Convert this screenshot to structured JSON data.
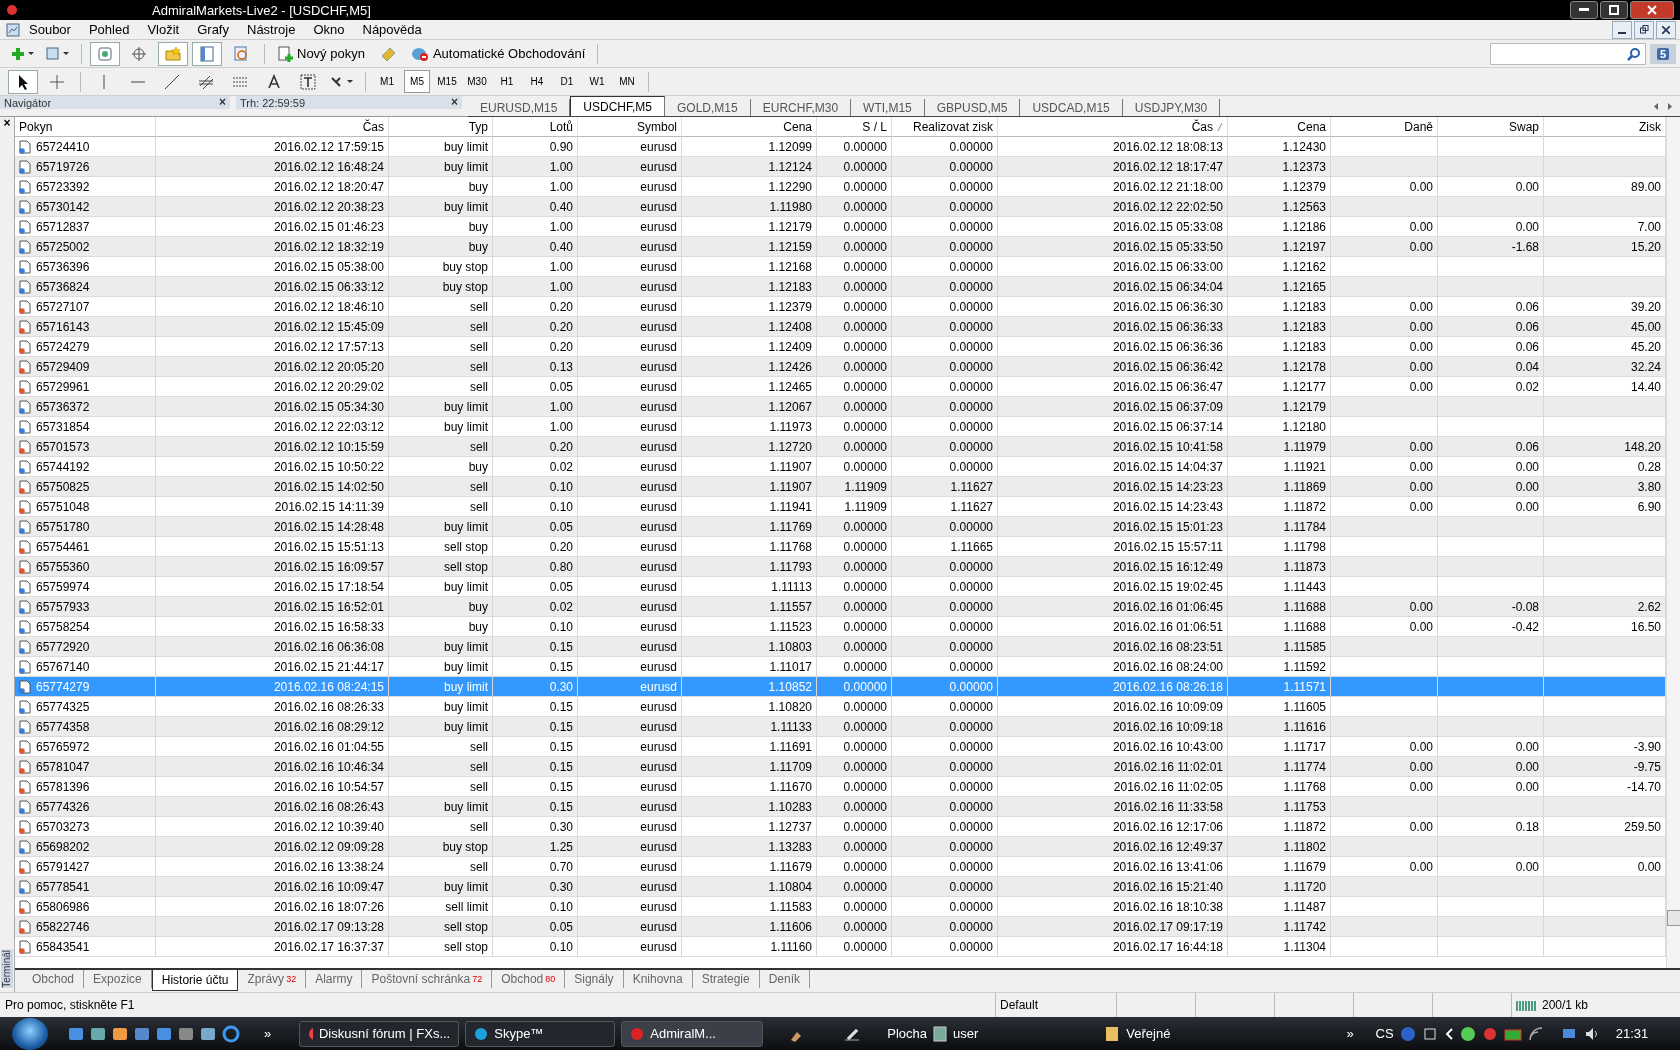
{
  "window": {
    "title": "AdmiralMarkets-Live2 - [USDCHF,M5]"
  },
  "menu": [
    "Soubor",
    "Pohled",
    "Vložit",
    "Grafy",
    "Nástroje",
    "Okno",
    "Nápověda"
  ],
  "toolbar": {
    "new_order": "Nový pokyn",
    "auto_trading": "Automatické Obchodování",
    "timeframes": [
      {
        "label": "M1",
        "selected": false
      },
      {
        "label": "M5",
        "selected": true
      },
      {
        "label": "M15",
        "selected": false
      },
      {
        "label": "M30",
        "selected": false
      },
      {
        "label": "H1",
        "selected": false
      },
      {
        "label": "H4",
        "selected": false
      },
      {
        "label": "D1",
        "selected": false
      },
      {
        "label": "W1",
        "selected": false
      },
      {
        "label": "MN",
        "selected": false
      }
    ],
    "messages_badge": "5"
  },
  "panels": {
    "navigator": "Navigátor",
    "market_watch": "Trh: 22:59:59",
    "close": "×"
  },
  "chart_tabs": [
    {
      "label": "EURUSD,M15",
      "selected": false
    },
    {
      "label": "USDCHF,M5",
      "selected": true
    },
    {
      "label": "GOLD,M15",
      "selected": false
    },
    {
      "label": "EURCHF,M30",
      "selected": false
    },
    {
      "label": "WTI,M15",
      "selected": false
    },
    {
      "label": "GBPUSD,M5",
      "selected": false
    },
    {
      "label": "USDCAD,M15",
      "selected": false
    },
    {
      "label": "USDJPY,M30",
      "selected": false
    }
  ],
  "terminal": {
    "close": "×",
    "label": "Terminál",
    "table": {
      "columns": [
        "Pokyn",
        "Čas",
        "Typ",
        "Lotů",
        "Symbol",
        "Cena",
        "S / L",
        "Realizovat zisk",
        "Čas",
        "Cena",
        "Daně",
        "Swap",
        "Zisk"
      ],
      "rows": [
        {
          "kind": "buy",
          "selected": false,
          "cells": [
            "65724410",
            "2016.02.12 17:59:15",
            "buy limit",
            "0.90",
            "eurusd",
            "1.12099",
            "0.00000",
            "0.00000",
            "2016.02.12 18:08:13",
            "1.12430",
            null,
            null,
            null
          ]
        },
        {
          "kind": "buy",
          "selected": false,
          "cells": [
            "65719726",
            "2016.02.12 16:48:24",
            "buy limit",
            "1.00",
            "eurusd",
            "1.12124",
            "0.00000",
            "0.00000",
            "2016.02.12 18:17:47",
            "1.12373",
            null,
            null,
            null
          ]
        },
        {
          "kind": "buy",
          "selected": false,
          "cells": [
            "65723392",
            "2016.02.12 18:20:47",
            "buy",
            "1.00",
            "eurusd",
            "1.12290",
            "0.00000",
            "0.00000",
            "2016.02.12 21:18:00",
            "1.12379",
            "0.00",
            "0.00",
            "89.00"
          ]
        },
        {
          "kind": "buy",
          "selected": false,
          "cells": [
            "65730142",
            "2016.02.12 20:38:23",
            "buy limit",
            "0.40",
            "eurusd",
            "1.11980",
            "0.00000",
            "0.00000",
            "2016.02.12 22:02:50",
            "1.12563",
            null,
            null,
            null
          ]
        },
        {
          "kind": "buy",
          "selected": false,
          "cells": [
            "65712837",
            "2016.02.15 01:46:23",
            "buy",
            "1.00",
            "eurusd",
            "1.12179",
            "0.00000",
            "0.00000",
            "2016.02.15 05:33:08",
            "1.12186",
            "0.00",
            "0.00",
            "7.00"
          ]
        },
        {
          "kind": "buy",
          "selected": false,
          "cells": [
            "65725002",
            "2016.02.12 18:32:19",
            "buy",
            "0.40",
            "eurusd",
            "1.12159",
            "0.00000",
            "0.00000",
            "2016.02.15 05:33:50",
            "1.12197",
            "0.00",
            "-1.68",
            "15.20"
          ]
        },
        {
          "kind": "buy",
          "selected": false,
          "cells": [
            "65736396",
            "2016.02.15 05:38:00",
            "buy stop",
            "1.00",
            "eurusd",
            "1.12168",
            "0.00000",
            "0.00000",
            "2016.02.15 06:33:00",
            "1.12162",
            null,
            null,
            null
          ]
        },
        {
          "kind": "buy",
          "selected": false,
          "cells": [
            "65736824",
            "2016.02.15 06:33:12",
            "buy stop",
            "1.00",
            "eurusd",
            "1.12183",
            "0.00000",
            "0.00000",
            "2016.02.15 06:34:04",
            "1.12165",
            null,
            null,
            null
          ]
        },
        {
          "kind": "sell",
          "selected": false,
          "cells": [
            "65727107",
            "2016.02.12 18:46:10",
            "sell",
            "0.20",
            "eurusd",
            "1.12379",
            "0.00000",
            "0.00000",
            "2016.02.15 06:36:30",
            "1.12183",
            "0.00",
            "0.06",
            "39.20"
          ]
        },
        {
          "kind": "sell",
          "selected": false,
          "cells": [
            "65716143",
            "2016.02.12 15:45:09",
            "sell",
            "0.20",
            "eurusd",
            "1.12408",
            "0.00000",
            "0.00000",
            "2016.02.15 06:36:33",
            "1.12183",
            "0.00",
            "0.06",
            "45.00"
          ]
        },
        {
          "kind": "sell",
          "selected": false,
          "cells": [
            "65724279",
            "2016.02.12 17:57:13",
            "sell",
            "0.20",
            "eurusd",
            "1.12409",
            "0.00000",
            "0.00000",
            "2016.02.15 06:36:36",
            "1.12183",
            "0.00",
            "0.06",
            "45.20"
          ]
        },
        {
          "kind": "sell",
          "selected": false,
          "cells": [
            "65729409",
            "2016.02.12 20:05:20",
            "sell",
            "0.13",
            "eurusd",
            "1.12426",
            "0.00000",
            "0.00000",
            "2016.02.15 06:36:42",
            "1.12178",
            "0.00",
            "0.04",
            "32.24"
          ]
        },
        {
          "kind": "sell",
          "selected": false,
          "cells": [
            "65729961",
            "2016.02.12 20:29:02",
            "sell",
            "0.05",
            "eurusd",
            "1.12465",
            "0.00000",
            "0.00000",
            "2016.02.15 06:36:47",
            "1.12177",
            "0.00",
            "0.02",
            "14.40"
          ]
        },
        {
          "kind": "buy",
          "selected": false,
          "cells": [
            "65736372",
            "2016.02.15 05:34:30",
            "buy limit",
            "1.00",
            "eurusd",
            "1.12067",
            "0.00000",
            "0.00000",
            "2016.02.15 06:37:09",
            "1.12179",
            null,
            null,
            null
          ]
        },
        {
          "kind": "buy",
          "selected": false,
          "cells": [
            "65731854",
            "2016.02.12 22:03:12",
            "buy limit",
            "1.00",
            "eurusd",
            "1.11973",
            "0.00000",
            "0.00000",
            "2016.02.15 06:37:14",
            "1.12180",
            null,
            null,
            null
          ]
        },
        {
          "kind": "sell",
          "selected": false,
          "cells": [
            "65701573",
            "2016.02.12 10:15:59",
            "sell",
            "0.20",
            "eurusd",
            "1.12720",
            "0.00000",
            "0.00000",
            "2016.02.15 10:41:58",
            "1.11979",
            "0.00",
            "0.06",
            "148.20"
          ]
        },
        {
          "kind": "buy",
          "selected": false,
          "cells": [
            "65744192",
            "2016.02.15 10:50:22",
            "buy",
            "0.02",
            "eurusd",
            "1.11907",
            "0.00000",
            "0.00000",
            "2016.02.15 14:04:37",
            "1.11921",
            "0.00",
            "0.00",
            "0.28"
          ]
        },
        {
          "kind": "sell",
          "selected": false,
          "cells": [
            "65750825",
            "2016.02.15 14:02:50",
            "sell",
            "0.10",
            "eurusd",
            "1.11907",
            "1.11909",
            "1.11627",
            "2016.02.15 14:23:23",
            "1.11869",
            "0.00",
            "0.00",
            "3.80"
          ]
        },
        {
          "kind": "sell",
          "selected": false,
          "cells": [
            "65751048",
            "2016.02.15 14:11:39",
            "sell",
            "0.10",
            "eurusd",
            "1.11941",
            "1.11909",
            "1.11627",
            "2016.02.15 14:23:43",
            "1.11872",
            "0.00",
            "0.00",
            "6.90"
          ]
        },
        {
          "kind": "buy",
          "selected": false,
          "cells": [
            "65751780",
            "2016.02.15 14:28:48",
            "buy limit",
            "0.05",
            "eurusd",
            "1.11769",
            "0.00000",
            "0.00000",
            "2016.02.15 15:01:23",
            "1.11784",
            null,
            null,
            null
          ]
        },
        {
          "kind": "sell",
          "selected": false,
          "cells": [
            "65754461",
            "2016.02.15 15:51:13",
            "sell stop",
            "0.20",
            "eurusd",
            "1.11768",
            "0.00000",
            "1.11665",
            "2016.02.15 15:57:11",
            "1.11798",
            null,
            null,
            null
          ]
        },
        {
          "kind": "sell",
          "selected": false,
          "cells": [
            "65755360",
            "2016.02.15 16:09:57",
            "sell stop",
            "0.80",
            "eurusd",
            "1.11793",
            "0.00000",
            "0.00000",
            "2016.02.15 16:12:49",
            "1.11873",
            null,
            null,
            null
          ]
        },
        {
          "kind": "buy",
          "selected": false,
          "cells": [
            "65759974",
            "2016.02.15 17:18:54",
            "buy limit",
            "0.05",
            "eurusd",
            "1.11113",
            "0.00000",
            "0.00000",
            "2016.02.15 19:02:45",
            "1.11443",
            null,
            null,
            null
          ]
        },
        {
          "kind": "buy",
          "selected": false,
          "cells": [
            "65757933",
            "2016.02.15 16:52:01",
            "buy",
            "0.02",
            "eurusd",
            "1.11557",
            "0.00000",
            "0.00000",
            "2016.02.16 01:06:45",
            "1.11688",
            "0.00",
            "-0.08",
            "2.62"
          ]
        },
        {
          "kind": "buy",
          "selected": false,
          "cells": [
            "65758254",
            "2016.02.15 16:58:33",
            "buy",
            "0.10",
            "eurusd",
            "1.11523",
            "0.00000",
            "0.00000",
            "2016.02.16 01:06:51",
            "1.11688",
            "0.00",
            "-0.42",
            "16.50"
          ]
        },
        {
          "kind": "buy",
          "selected": false,
          "cells": [
            "65772920",
            "2016.02.16 06:36:08",
            "buy limit",
            "0.15",
            "eurusd",
            "1.10803",
            "0.00000",
            "0.00000",
            "2016.02.16 08:23:51",
            "1.11585",
            null,
            null,
            null
          ]
        },
        {
          "kind": "buy",
          "selected": false,
          "cells": [
            "65767140",
            "2016.02.15 21:44:17",
            "buy limit",
            "0.15",
            "eurusd",
            "1.11017",
            "0.00000",
            "0.00000",
            "2016.02.16 08:24:00",
            "1.11592",
            null,
            null,
            null
          ]
        },
        {
          "kind": "buy",
          "selected": true,
          "cells": [
            "65774279",
            "2016.02.16 08:24:15",
            "buy limit",
            "0.30",
            "eurusd",
            "1.10852",
            "0.00000",
            "0.00000",
            "2016.02.16 08:26:18",
            "1.11571",
            null,
            null,
            null
          ]
        },
        {
          "kind": "buy",
          "selected": false,
          "cells": [
            "65774325",
            "2016.02.16 08:26:33",
            "buy limit",
            "0.15",
            "eurusd",
            "1.10820",
            "0.00000",
            "0.00000",
            "2016.02.16 10:09:09",
            "1.11605",
            null,
            null,
            null
          ]
        },
        {
          "kind": "buy",
          "selected": false,
          "cells": [
            "65774358",
            "2016.02.16 08:29:12",
            "buy limit",
            "0.15",
            "eurusd",
            "1.11133",
            "0.00000",
            "0.00000",
            "2016.02.16 10:09:18",
            "1.11616",
            null,
            null,
            null
          ]
        },
        {
          "kind": "sell",
          "selected": false,
          "cells": [
            "65765972",
            "2016.02.16 01:04:55",
            "sell",
            "0.15",
            "eurusd",
            "1.11691",
            "0.00000",
            "0.00000",
            "2016.02.16 10:43:00",
            "1.11717",
            "0.00",
            "0.00",
            "-3.90"
          ]
        },
        {
          "kind": "sell",
          "selected": false,
          "cells": [
            "65781047",
            "2016.02.16 10:46:34",
            "sell",
            "0.15",
            "eurusd",
            "1.11709",
            "0.00000",
            "0.00000",
            "2016.02.16 11:02:01",
            "1.11774",
            "0.00",
            "0.00",
            "-9.75"
          ]
        },
        {
          "kind": "sell",
          "selected": false,
          "cells": [
            "65781396",
            "2016.02.16 10:54:57",
            "sell",
            "0.15",
            "eurusd",
            "1.11670",
            "0.00000",
            "0.00000",
            "2016.02.16 11:02:05",
            "1.11768",
            "0.00",
            "0.00",
            "-14.70"
          ]
        },
        {
          "kind": "buy",
          "selected": false,
          "cells": [
            "65774326",
            "2016.02.16 08:26:43",
            "buy limit",
            "0.15",
            "eurusd",
            "1.10283",
            "0.00000",
            "0.00000",
            "2016.02.16 11:33:58",
            "1.11753",
            null,
            null,
            null
          ]
        },
        {
          "kind": "sell",
          "selected": false,
          "cells": [
            "65703273",
            "2016.02.12 10:39:40",
            "sell",
            "0.30",
            "eurusd",
            "1.12737",
            "0.00000",
            "0.00000",
            "2016.02.16 12:17:06",
            "1.11872",
            "0.00",
            "0.18",
            "259.50"
          ]
        },
        {
          "kind": "buy",
          "selected": false,
          "cells": [
            "65698202",
            "2016.02.12 09:09:28",
            "buy stop",
            "1.25",
            "eurusd",
            "1.13283",
            "0.00000",
            "0.00000",
            "2016.02.16 12:49:37",
            "1.11802",
            null,
            null,
            null
          ]
        },
        {
          "kind": "sell",
          "selected": false,
          "cells": [
            "65791427",
            "2016.02.16 13:38:24",
            "sell",
            "0.70",
            "eurusd",
            "1.11679",
            "0.00000",
            "0.00000",
            "2016.02.16 13:41:06",
            "1.11679",
            "0.00",
            "0.00",
            "0.00"
          ]
        },
        {
          "kind": "buy",
          "selected": false,
          "cells": [
            "65778541",
            "2016.02.16 10:09:47",
            "buy limit",
            "0.30",
            "eurusd",
            "1.10804",
            "0.00000",
            "0.00000",
            "2016.02.16 15:21:40",
            "1.11720",
            null,
            null,
            null
          ]
        },
        {
          "kind": "sell",
          "selected": false,
          "cells": [
            "65806986",
            "2016.02.16 18:07:26",
            "sell limit",
            "0.10",
            "eurusd",
            "1.11583",
            "0.00000",
            "0.00000",
            "2016.02.16 18:10:38",
            "1.11487",
            null,
            null,
            null
          ]
        },
        {
          "kind": "sell",
          "selected": false,
          "cells": [
            "65822746",
            "2016.02.17 09:13:28",
            "sell stop",
            "0.05",
            "eurusd",
            "1.11606",
            "0.00000",
            "0.00000",
            "2016.02.17 09:17:19",
            "1.11742",
            null,
            null,
            null
          ]
        },
        {
          "kind": "sell",
          "selected": false,
          "cells": [
            "65843541",
            "2016.02.17 16:37:37",
            "sell stop",
            "0.10",
            "eurusd",
            "1.11160",
            "0.00000",
            "0.00000",
            "2016.02.17 16:44:18",
            "1.11304",
            null,
            null,
            null
          ]
        }
      ]
    },
    "tabs": [
      {
        "label": "Obchod",
        "selected": false
      },
      {
        "label": "Expozice",
        "selected": false
      },
      {
        "label": "Historie účtu",
        "selected": true
      },
      {
        "label": "Zprávy",
        "count": "32",
        "selected": false
      },
      {
        "label": "Alarmy",
        "selected": false
      },
      {
        "label": "Poštovní schránka",
        "count": "72",
        "selected": false
      },
      {
        "label": "Obchod",
        "count": "80",
        "selected": false
      },
      {
        "label": "Signály",
        "selected": false
      },
      {
        "label": "Knihovna",
        "selected": false
      },
      {
        "label": "Strategie",
        "selected": false
      },
      {
        "label": "Deník",
        "selected": false
      }
    ]
  },
  "status_bar": {
    "help": "Pro pomoc, stiskněte F1",
    "profile": "Default",
    "traffic": "200/1 kb"
  },
  "taskbar": {
    "more": "»",
    "windows": [
      {
        "label": "Diskusní fórum | FXs...",
        "selected": false
      },
      {
        "label": "Skype™",
        "selected": false
      },
      {
        "label": "AdmiralM...",
        "selected": true
      }
    ],
    "toolbars": [
      "Plocha",
      "user",
      "Veřejné"
    ],
    "tray_more": "»",
    "language": "CS",
    "clock": "21:31"
  }
}
